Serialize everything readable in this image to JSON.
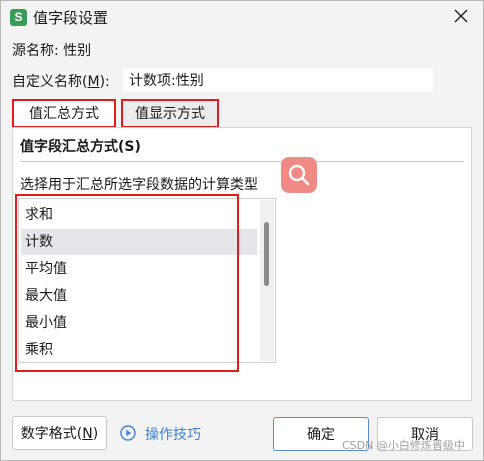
{
  "window": {
    "title": "值字段设置",
    "app_icon": "S",
    "app_icon_color": "#3c9b54"
  },
  "source": {
    "label": "源名称:",
    "value": "性别"
  },
  "custom_name": {
    "label_prefix": "自定义名称(",
    "label_key": "M",
    "label_suffix": "):",
    "value": "计数项:性别"
  },
  "tabs": [
    {
      "label": "值汇总方式",
      "active": true
    },
    {
      "label": "值显示方式",
      "active": false
    }
  ],
  "panel": {
    "group_title": "值字段汇总方式(S)",
    "description": "选择用于汇总所选字段数据的计算类型",
    "items": [
      "求和",
      "计数",
      "平均值",
      "最大值",
      "最小值",
      "乘积"
    ],
    "selected": "计数"
  },
  "buttons": {
    "number_format_prefix": "数字格式(",
    "number_format_key": "N",
    "number_format_suffix": ")",
    "tips": "操作技巧",
    "ok": "确定",
    "cancel": "取消"
  },
  "watermark": "CSDN @小白修炼晋级中",
  "colors": {
    "highlight_red": "#e21b1b",
    "link_blue": "#3b82d6",
    "search_float": "#ef8b84",
    "selected_row": "#e5e6ea"
  },
  "icons": {
    "app": "spreadsheet-icon",
    "close": "close-icon",
    "search": "search-icon",
    "tips": "play-circle-icon"
  }
}
